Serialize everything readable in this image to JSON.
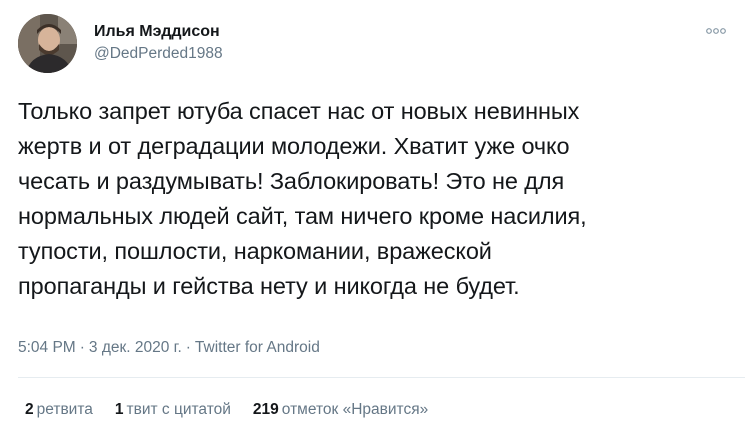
{
  "author": {
    "display_name": "Илья Мэддисон",
    "handle": "@DedPerded1988",
    "avatar_icon": "user-avatar-photo"
  },
  "more_icon": "more-options-icon",
  "tweet": {
    "text": "Только запрет ютуба спасет нас от новых невинных\nжертв и от деградации молодежи. Хватит уже очко\nчесать и раздумывать! Заблокировать! Это не для\nнормальных людей сайт, там ничего кроме насилия,\nтупости, пошлости, наркомании, вражеской\nпропаганды и гейства нету и никогда не будет."
  },
  "meta": {
    "time": "5:04 PM",
    "separator": "·",
    "date": "3 дек. 2020 г.",
    "source": "Twitter for Android"
  },
  "stats": {
    "retweets_count": "2",
    "retweets_label": "ретвита",
    "quotes_count": "1",
    "quotes_label": "твит с цитатой",
    "likes_count": "219",
    "likes_label": "отметок «Нравится»"
  },
  "colors": {
    "text": "#14171a",
    "secondary": "#657786",
    "divider": "#e6ecf0"
  }
}
